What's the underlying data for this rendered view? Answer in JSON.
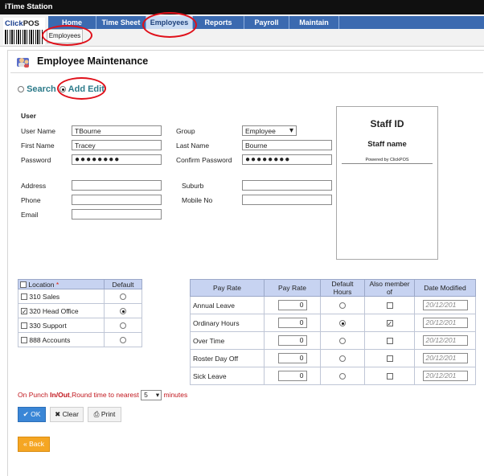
{
  "app": {
    "title": "iTime Station",
    "brand_a": "Click",
    "brand_b": "POS"
  },
  "nav": {
    "tabs": [
      "Home",
      "Time Sheet",
      "Employees",
      "Reports",
      "Payroll",
      "Maintain"
    ],
    "active": "Employees",
    "subtab": "Employees"
  },
  "page": {
    "title": "Employee Maintenance"
  },
  "modes": {
    "search": "Search",
    "add_edit": "Add Edit",
    "selected": "Add Edit"
  },
  "user": {
    "section": "User",
    "username_label": "User Name",
    "username": "TBourne",
    "group_label": "Group",
    "group": "Employee",
    "firstname_label": "First Name",
    "firstname": "Tracey",
    "lastname_label": "Last Name",
    "lastname": "Bourne",
    "password_label": "Password",
    "password": "●●●●●●●●",
    "confirm_label": "Confirm Password",
    "confirm": "●●●●●●●●",
    "address_label": "Address",
    "address": "",
    "suburb_label": "Suburb",
    "suburb": "",
    "phone_label": "Phone",
    "phone": "",
    "mobile_label": "Mobile No",
    "mobile": "",
    "email_label": "Email",
    "email": ""
  },
  "card": {
    "staff_id": "Staff ID",
    "staff_name": "Staff name",
    "powered": "Powered by ClickPOS"
  },
  "locations": {
    "header": "Location",
    "required": "*",
    "default_header": "Default",
    "rows": [
      {
        "name": "310 Sales",
        "checked": false,
        "default": false
      },
      {
        "name": "320 Head Office",
        "checked": true,
        "default": true
      },
      {
        "name": "330 Support",
        "checked": false,
        "default": false
      },
      {
        "name": "888 Accounts",
        "checked": false,
        "default": false
      }
    ]
  },
  "payrates": {
    "headers": [
      "Pay Rate",
      "Pay Rate",
      "Default Hours",
      "Also member of",
      "Date Modified"
    ],
    "rows": [
      {
        "name": "Annual Leave",
        "rate": "0",
        "default": false,
        "member": false,
        "date": "20/12/201"
      },
      {
        "name": "Ordinary Hours",
        "rate": "0",
        "default": true,
        "member": true,
        "date": "20/12/201"
      },
      {
        "name": "Over Time",
        "rate": "0",
        "default": false,
        "member": false,
        "date": "20/12/201"
      },
      {
        "name": "Roster Day Off",
        "rate": "0",
        "default": false,
        "member": false,
        "date": "20/12/201"
      },
      {
        "name": "Sick Leave",
        "rate": "0",
        "default": false,
        "member": false,
        "date": "20/12/201"
      }
    ]
  },
  "punch": {
    "prefix": "On Punch ",
    "inout": "In/Out",
    "mid": ",Round time to nearest",
    "value": "5",
    "suffix": "minutes"
  },
  "buttons": {
    "ok": "OK",
    "clear": "Clear",
    "print": "Print",
    "back": "Back"
  }
}
